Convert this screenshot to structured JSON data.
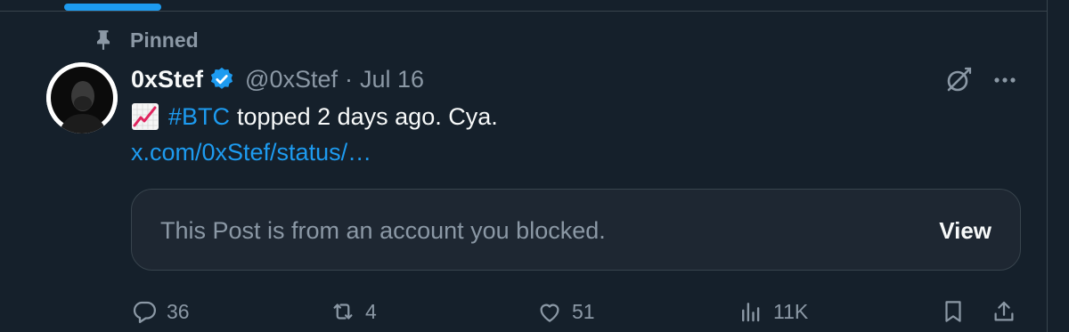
{
  "pinned": {
    "label": "Pinned"
  },
  "tweet": {
    "display_name": "0xStef",
    "handle": "@0xStef",
    "separator": "·",
    "date": "Jul 16",
    "hashtag": "#BTC",
    "body": "topped 2 days ago. Cya.",
    "link": "x.com/0xStef/status/…",
    "verified": true
  },
  "blocked_card": {
    "message": "This Post is from an account you blocked.",
    "view_label": "View"
  },
  "actions": {
    "replies": "36",
    "reposts": "4",
    "likes": "51",
    "views": "11K"
  },
  "colors": {
    "background": "#15202b",
    "accent": "#1d9bf0",
    "muted": "#8b98a5",
    "text": "#f7f9f9",
    "card": "#1e2732",
    "border": "#38444d"
  },
  "icons": {
    "pin": "pin-icon",
    "verified": "verified-badge-icon",
    "grok": "grok-icon",
    "more": "more-icon",
    "emoji": "chart-increasing-emoji",
    "reply": "reply-icon",
    "repost": "repost-icon",
    "like": "heart-icon",
    "views": "views-icon",
    "bookmark": "bookmark-icon",
    "share": "share-icon"
  }
}
